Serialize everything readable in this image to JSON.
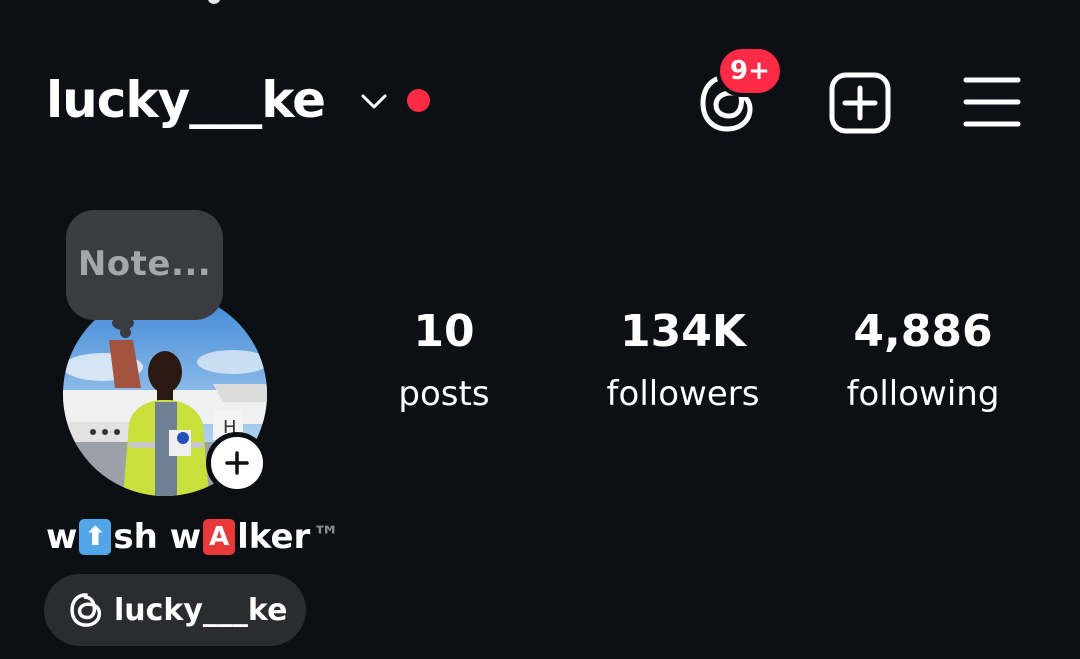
{
  "header": {
    "username": "lucky___ke",
    "notification_badge": "9+",
    "accent_color": "#ff2a45"
  },
  "note": {
    "placeholder": "Note..."
  },
  "stats": [
    {
      "value": "10",
      "label": "posts"
    },
    {
      "value": "134K",
      "label": "followers"
    },
    {
      "value": "4,886",
      "label": "following"
    }
  ],
  "profile": {
    "display_name_parts": [
      "w",
      "⬆",
      "sh w",
      "A",
      "lker",
      "™"
    ],
    "threads_handle": "lucky___ke"
  },
  "icons": {
    "threads": "threads-icon",
    "create": "plus-square-icon",
    "menu": "hamburger-menu-icon",
    "account_switch": "chevron-down-icon",
    "add_story": "plus-icon"
  }
}
